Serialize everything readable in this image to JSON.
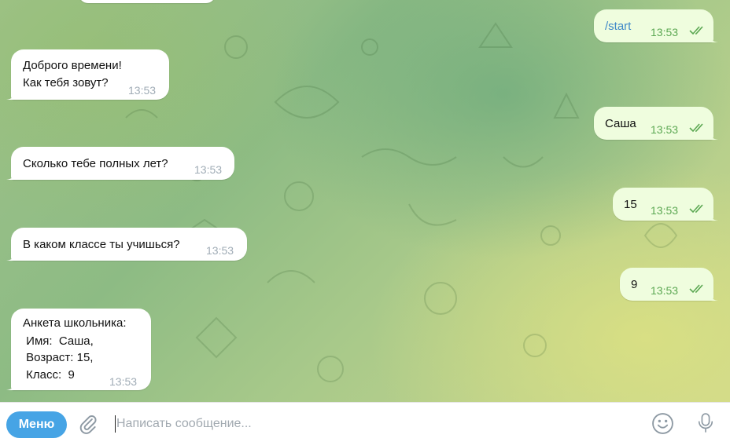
{
  "messages": [
    {
      "side": "out",
      "lines": [
        "/start"
      ],
      "time": "13:53",
      "is_command": true
    },
    {
      "side": "in",
      "lines": [
        "Доброго времени!",
        "Как тебя зовут?"
      ],
      "time": "13:53"
    },
    {
      "side": "out",
      "lines": [
        "Саша"
      ],
      "time": "13:53"
    },
    {
      "side": "in",
      "lines": [
        "Сколько тебе полных лет?"
      ],
      "time": "13:53"
    },
    {
      "side": "out",
      "lines": [
        "15"
      ],
      "time": "13:53"
    },
    {
      "side": "in",
      "lines": [
        "В каком классе ты учишься?"
      ],
      "time": "13:53"
    },
    {
      "side": "out",
      "lines": [
        "9"
      ],
      "time": "13:53"
    },
    {
      "side": "in",
      "lines": [
        "Анкета школьника:",
        " Имя:  Саша,",
        " Возраст: 15,",
        " Класс:  9"
      ],
      "time": "13:53"
    }
  ],
  "composer": {
    "menu_label": "Меню",
    "placeholder": "Написать сообщение...",
    "value": ""
  },
  "icons": {
    "attach": "paperclip-icon",
    "emoji": "smile-icon",
    "voice": "microphone-icon",
    "read_status": "double-check-icon"
  },
  "colors": {
    "incoming_bubble": "#ffffff",
    "outgoing_bubble": "#effdde",
    "menu_button": "#46a4e5",
    "time_outgoing": "#5ca853",
    "command_link": "#3e88c8"
  }
}
